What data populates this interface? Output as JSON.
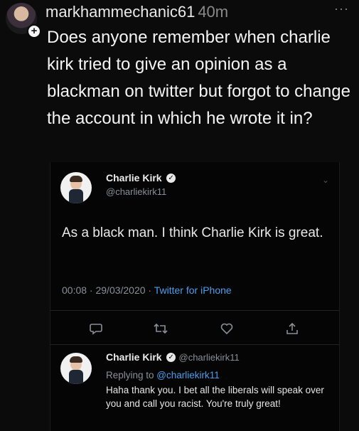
{
  "post": {
    "username": "markhammechanic61",
    "time": "40m",
    "more": "···",
    "body": "Does anyone remember when charlie kirk tried to give an opinion as a blackman on twitter but forgot to change the account in which he wrote it in?"
  },
  "tweet": {
    "name": "Charlie Kirk",
    "handle": "@charliekirk11",
    "text": "As a black man. I think Charlie Kirk is great.",
    "timestamp": "00:08 · 29/03/2020 · ",
    "source": "Twitter for iPhone"
  },
  "reply": {
    "name": "Charlie Kirk",
    "handle": "@charliekirk11",
    "replying_prefix": "Replying to ",
    "replying_to": "@charliekirk11",
    "text": "Haha thank you. I bet all the liberals will speak over you and call you racist. You're truly great!"
  },
  "icons": [
    "reply-icon",
    "retweet-icon",
    "like-icon",
    "share-icon",
    "verified-icon",
    "chevron-down-icon",
    "more-icon",
    "follow-plus-icon"
  ],
  "colors": {
    "background": "#0b0b0b",
    "link": "#4a9eed",
    "muted": "#8a8f96"
  }
}
